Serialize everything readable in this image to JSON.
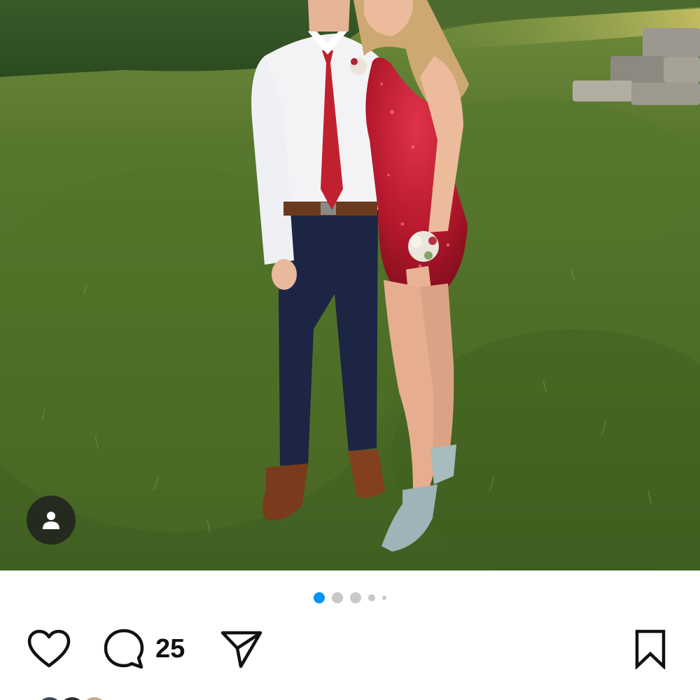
{
  "post": {
    "photo": {
      "alt_icon": "photo",
      "tag_icon": "person-icon"
    },
    "carousel": {
      "total_dots": 5,
      "active_index": 0,
      "active_color": "#0095f6",
      "inactive_color": "#c8c8c8"
    },
    "actions": {
      "like_icon": "heart-icon",
      "comment_icon": "comment-bubble-icon",
      "comment_count": "25",
      "share_icon": "paper-plane-icon",
      "save_icon": "bookmark-icon"
    }
  }
}
